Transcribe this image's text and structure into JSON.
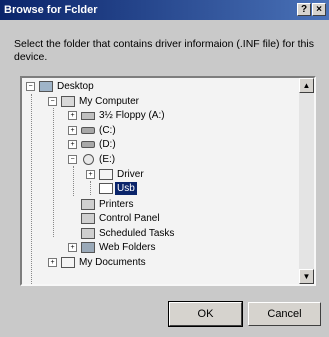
{
  "window": {
    "title": "Browse for Fclder",
    "help_label": "?",
    "close_label": "×"
  },
  "description": "Select the folder that contains driver informaion (.INF file) for this device.",
  "tree": {
    "items": [
      {
        "label": "Desktop",
        "icon": "desktop-icon",
        "expander": "−"
      },
      {
        "label": "My Computer",
        "icon": "my-computer-icon",
        "expander": "−"
      },
      {
        "label": "3½ Floppy (A:)",
        "icon": "floppy-drive-icon",
        "expander": "+"
      },
      {
        "label": "(C:)",
        "icon": "hard-drive-icon",
        "expander": "+"
      },
      {
        "label": "(D:)",
        "icon": "hard-drive-icon",
        "expander": "+"
      },
      {
        "label": "(E:)",
        "icon": "cd-drive-icon",
        "expander": "−"
      },
      {
        "label": "Driver",
        "icon": "folder-icon",
        "expander": "+"
      },
      {
        "label": "Usb",
        "icon": "open-folder-icon",
        "expander": "",
        "selected": true
      },
      {
        "label": "Printers",
        "icon": "printers-icon",
        "expander": ""
      },
      {
        "label": "Control Panel",
        "icon": "control-panel-icon",
        "expander": ""
      },
      {
        "label": "Scheduled Tasks",
        "icon": "scheduled-tasks-icon",
        "expander": ""
      },
      {
        "label": "Web Folders",
        "icon": "web-folders-icon",
        "expander": "+"
      },
      {
        "label": "My Documents",
        "icon": "my-documents-icon",
        "expander": "+"
      }
    ]
  },
  "scrollbar": {
    "up_label": "▲",
    "down_label": "▼"
  },
  "buttons": {
    "ok": "OK",
    "cancel": "Cancel"
  }
}
